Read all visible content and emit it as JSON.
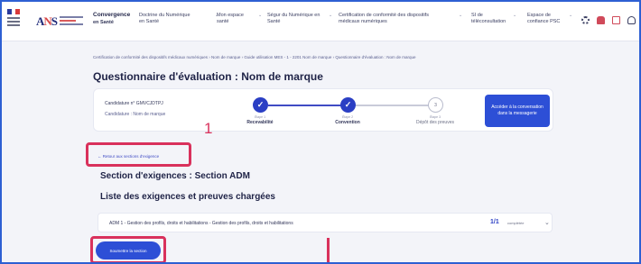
{
  "header": {
    "brand_line1": "Convergence",
    "brand_line2": "en Santé",
    "nav": [
      {
        "label_l1": "Doctrine du Numérique",
        "label_l2": "en Santé"
      },
      {
        "label_l1": "Mon espace",
        "label_l2": "santé"
      },
      {
        "label_l1": "Ségur du Numérique en",
        "label_l2": "Santé"
      },
      {
        "label_l1": "Certification de conformité des dispositifs",
        "label_l2": "médicaux numériques"
      },
      {
        "label_l1": "SI de",
        "label_l2": "téléconsultation"
      },
      {
        "label_l1": "Espace de",
        "label_l2": "confiance PSC"
      }
    ],
    "icons": [
      "gear-icon",
      "bell-icon",
      "mail-icon",
      "user-icon"
    ]
  },
  "breadcrumb": "Certification de conformité des dispositifs médicaux numériques  ›  Nom de marque  ›  Guide utilisation MES - 1 - 2201 Nom de marque  ›  Questionnaire d'évaluation : Nom de marque",
  "page_title": "Questionnaire d'évaluation : Nom de marque",
  "candidature": {
    "number": "Candidature n° GMVCJDTPJ",
    "name": "Candidature : Nom de marque"
  },
  "steps": [
    {
      "small": "Étape 1",
      "label": "Recevabilité",
      "state": "done",
      "glyph": "✓"
    },
    {
      "small": "Étape 2",
      "label": "Convention",
      "state": "done",
      "glyph": "✓"
    },
    {
      "small": "Étape 3",
      "label": "Dépôt des preuves",
      "state": "todo",
      "glyph": "3"
    }
  ],
  "messaging_button": "Accéder à la conversation dans la messagerie",
  "back_link": "← Retour aux sections d'exigence",
  "annotation_1": "1",
  "section_title": "Section d'exigences : Section ADM",
  "list_title": "Liste des exigences et preuves chargées",
  "requirement": {
    "text": "ADM 1 - Gestion des profils, droits et habilitations - Gestion des profils, droits et habilitations",
    "count": "1/1",
    "status": "complétée",
    "chevron": "⌄"
  },
  "submit_button": "Soumettre la section"
}
